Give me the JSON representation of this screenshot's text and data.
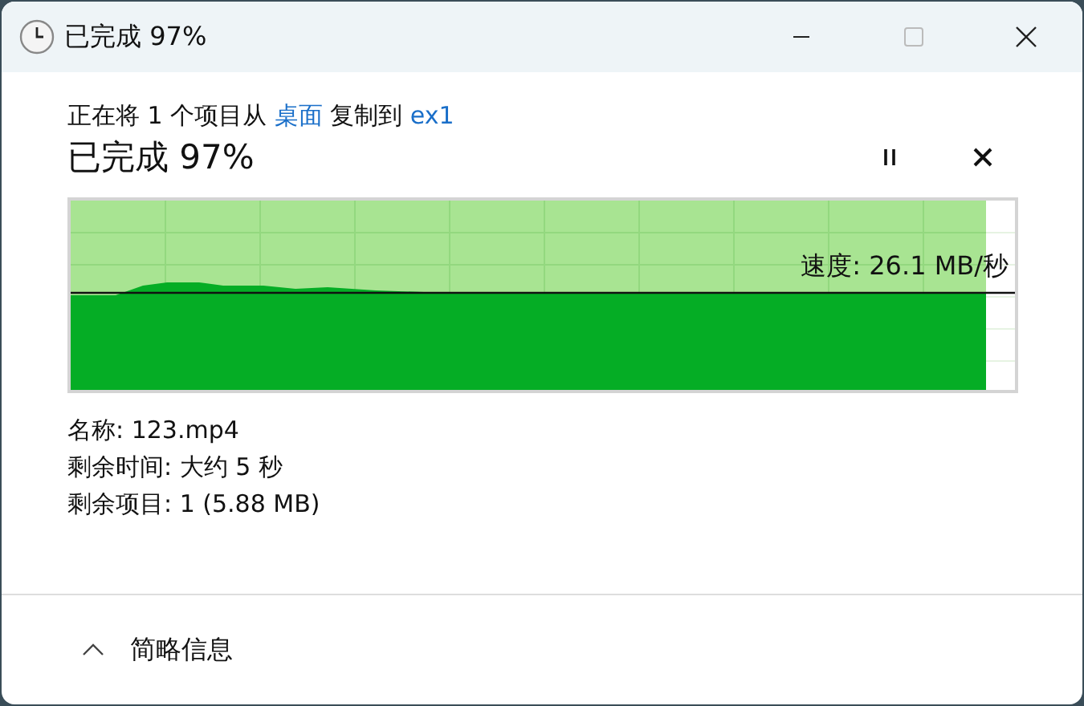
{
  "window": {
    "title": "已完成 97%",
    "maximize_disabled": true
  },
  "operation": [
    {
      "kind": "text",
      "text": "正在将 1 个项目从 "
    },
    {
      "kind": "link",
      "text": "桌面"
    },
    {
      "kind": "text",
      "text": " 复制到 "
    },
    {
      "kind": "link",
      "text": "ex1"
    }
  ],
  "heading": "已完成 97%",
  "progress": {
    "level": 0.97,
    "speed": "速度: 26.1 MB/秒"
  },
  "details": [
    "名称: 123.mp4",
    "剩余时间: 大约 5 秒",
    "剩余项目: 1 (5.88 MB)"
  ],
  "footer": {
    "label": "简略信息",
    "expanded": true
  }
}
